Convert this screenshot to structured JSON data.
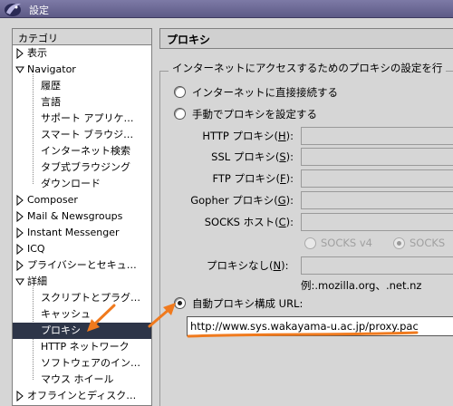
{
  "window": {
    "title": "設定"
  },
  "categories": {
    "header": "カテゴリ",
    "items": [
      {
        "label": "表示",
        "tw": "collapsed"
      },
      {
        "label": "Navigator",
        "tw": "expanded"
      },
      {
        "label": "履歴",
        "tw": "none"
      },
      {
        "label": "言語",
        "tw": "none"
      },
      {
        "label": "サポート アプリケ…",
        "tw": "none"
      },
      {
        "label": "スマート ブラウジ…",
        "tw": "none"
      },
      {
        "label": "インターネット検索",
        "tw": "none"
      },
      {
        "label": "タブ式ブラウジング",
        "tw": "none"
      },
      {
        "label": "ダウンロード",
        "tw": "none"
      },
      {
        "label": "Composer",
        "tw": "collapsed"
      },
      {
        "label": "Mail & Newsgroups",
        "tw": "collapsed"
      },
      {
        "label": "Instant Messenger",
        "tw": "collapsed"
      },
      {
        "label": "ICQ",
        "tw": "collapsed"
      },
      {
        "label": "プライバシーとセキュ…",
        "tw": "collapsed"
      },
      {
        "label": "詳細",
        "tw": "expanded"
      },
      {
        "label": "スクリプトとプラグ…",
        "tw": "none"
      },
      {
        "label": "キャッシュ",
        "tw": "none"
      },
      {
        "label": "プロキシ",
        "tw": "none",
        "selected": true
      },
      {
        "label": "HTTP ネットワーク",
        "tw": "none"
      },
      {
        "label": "ソフトウェアのイン…",
        "tw": "none"
      },
      {
        "label": "マウス ホイール",
        "tw": "none"
      },
      {
        "label": "オフラインとディスク…",
        "tw": "collapsed"
      }
    ]
  },
  "proxy": {
    "title": "プロキシ",
    "group_label": "インターネットにアクセスするためのプロキシの設定を行",
    "direct_label": "インターネットに直接接続する",
    "manual_label": "手動でプロキシを設定する",
    "fields": [
      {
        "pre": "HTTP プロキシ(",
        "key": "H",
        "post": "):"
      },
      {
        "pre": "SSL プロキシ(",
        "key": "S",
        "post": "):"
      },
      {
        "pre": "FTP プロキシ(",
        "key": "F",
        "post": "):"
      },
      {
        "pre": "Gopher プロキシ(",
        "key": "G",
        "post": "):"
      },
      {
        "pre": "SOCKS ホスト(",
        "key": "C",
        "post": "):"
      }
    ],
    "socks_v4": "SOCKS v4",
    "socks_v5": "SOCKS",
    "no_proxy": {
      "pre": "プロキシなし(",
      "key": "N",
      "post": "):"
    },
    "example": "例:.mozilla.org、.net.nz",
    "auto_label": "自動プロキシ構成 URL:",
    "auto_url": "http://www.sys.wakayama-u.ac.jp/proxy.pac"
  },
  "colors": {
    "arrow": "#f07a1e",
    "selection": "#2d3548",
    "titlebar": "#6e6b98"
  }
}
